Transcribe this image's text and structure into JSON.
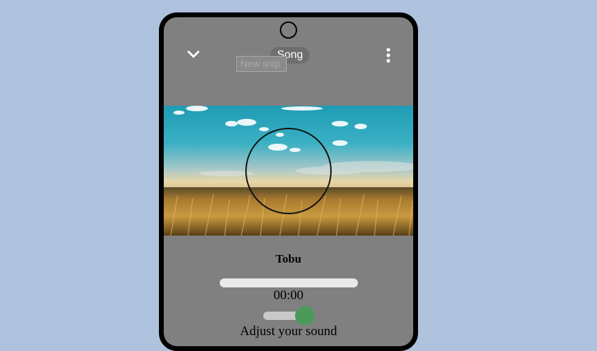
{
  "header": {
    "title": "Song",
    "snip_tooltip": "New snip",
    "back_icon": "chevron-down-icon",
    "menu_icon": "more-vertical-icon"
  },
  "track": {
    "title": "Tobu",
    "current_time": "00:00",
    "progress": 0
  },
  "volume": {
    "level": 0.85,
    "label": "Adjust your sound"
  },
  "colors": {
    "screen": "#808080",
    "page_background": "#afc3de",
    "volume_thumb": "#4b9a5a"
  }
}
